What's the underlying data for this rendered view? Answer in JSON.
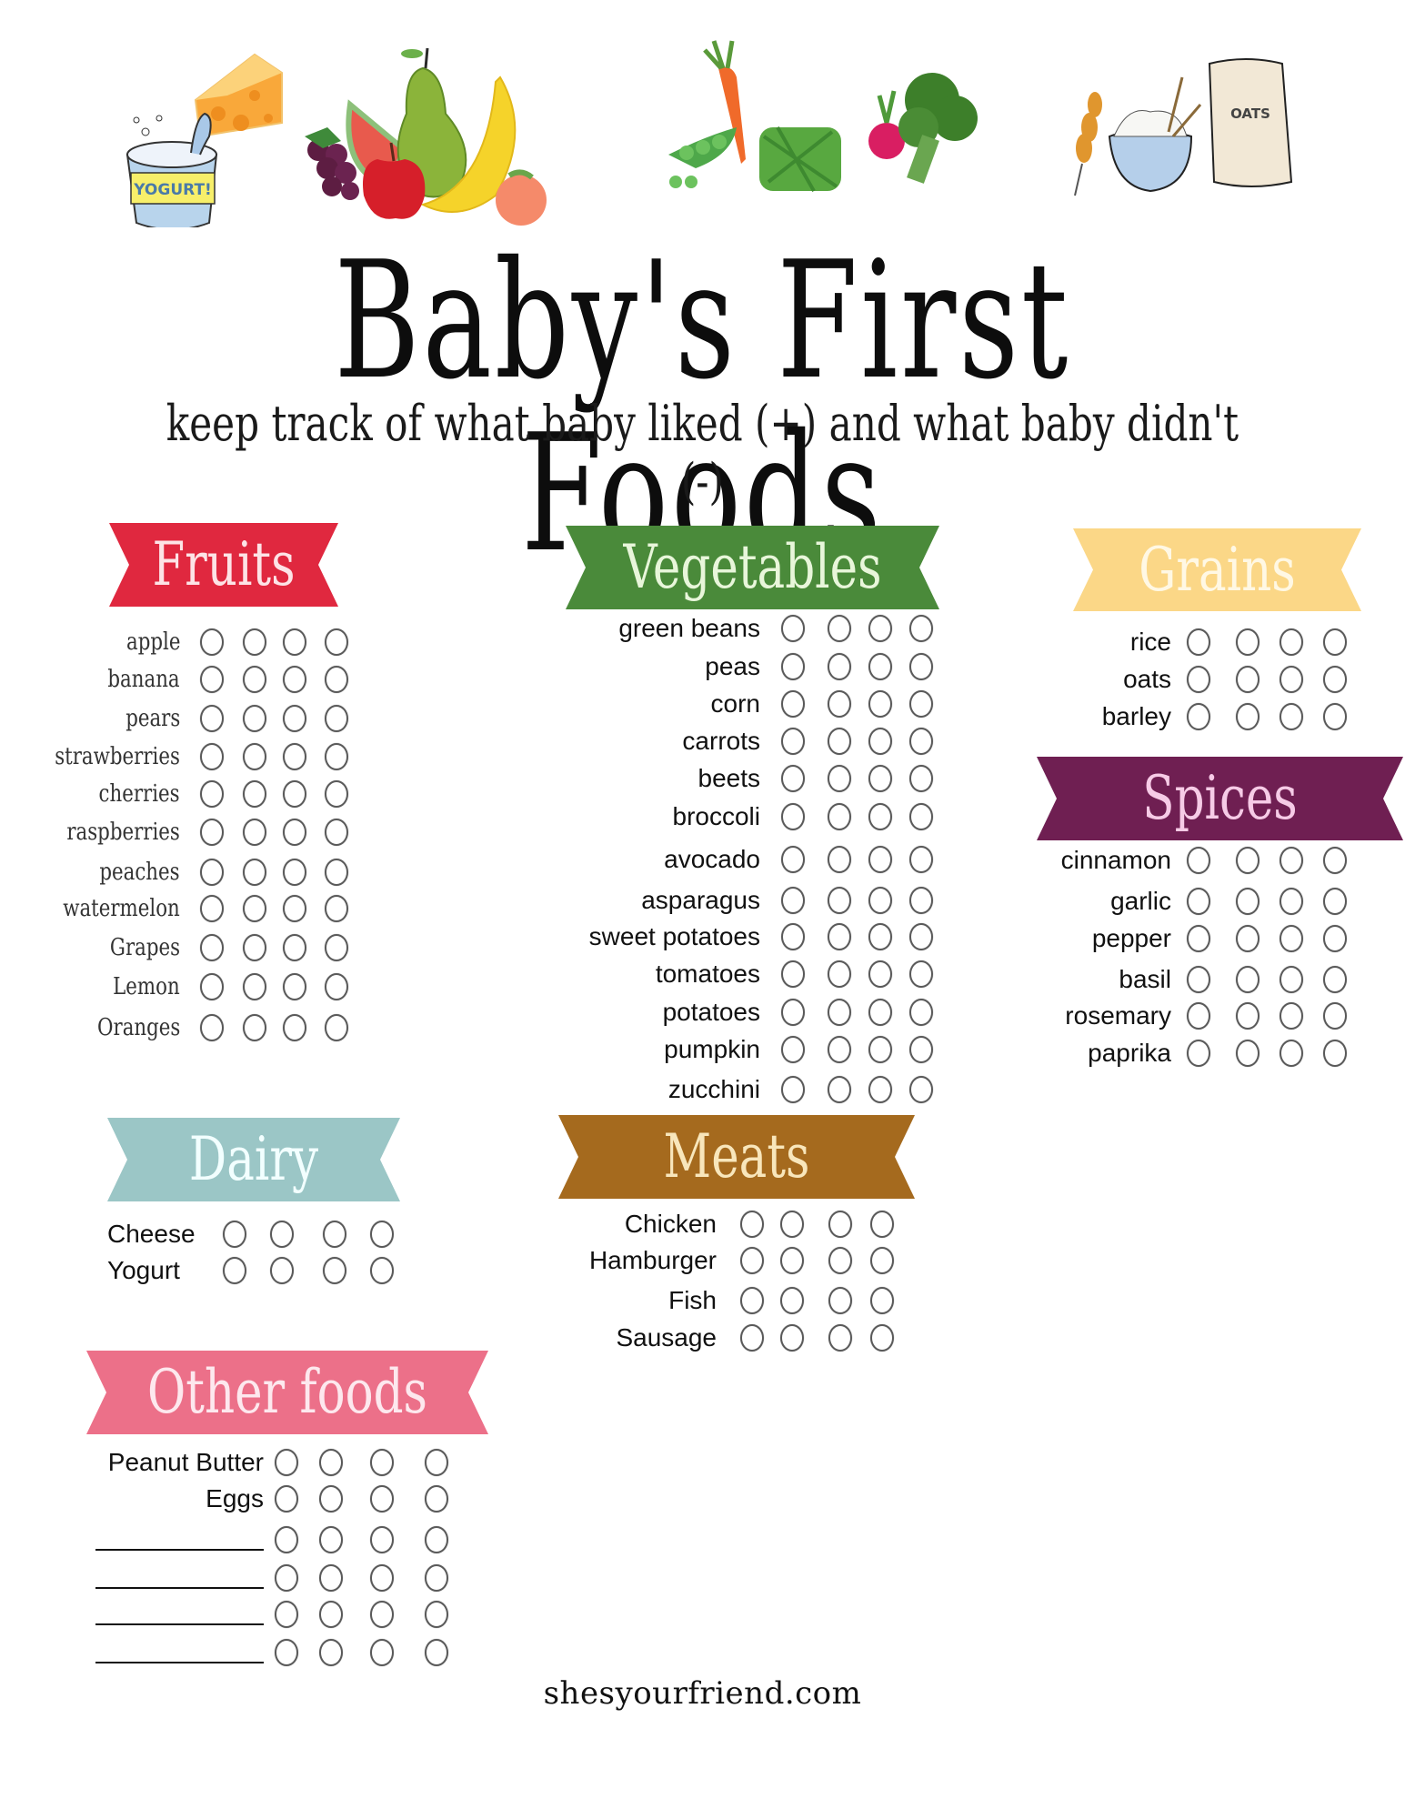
{
  "header": {
    "illustrations": [
      {
        "name": "dairy-illustration",
        "items": [
          "yogurt",
          "cheese"
        ],
        "yogurt_label": "YOGURT!"
      },
      {
        "name": "fruits-illustration",
        "items": [
          "grapes",
          "watermelon",
          "pear",
          "apple",
          "banana",
          "peach"
        ]
      },
      {
        "name": "vegetables-illustration",
        "items": [
          "peas",
          "carrot",
          "green beans",
          "radish",
          "broccoli"
        ]
      },
      {
        "name": "grains-illustration",
        "items": [
          "wheat",
          "rice bowl",
          "oats bag"
        ],
        "oats_label": "OATS"
      }
    ],
    "title": "Baby's First Foods",
    "subtitle": "keep track of what baby liked (+) and what baby didn't (-)"
  },
  "sections": {
    "fruits": {
      "title": "Fruits",
      "color": "#e0283f",
      "text_color": "#fde3e6",
      "items": [
        "apple",
        "banana",
        "pears",
        "strawberries",
        "cherries",
        "raspberries",
        "peaches",
        "watermelon",
        "Grapes",
        "Lemon",
        "Oranges"
      ]
    },
    "vegetables": {
      "title": "Vegetables",
      "color": "#4a8a3a",
      "text_color": "#e8f6da",
      "items": [
        "green beans",
        "peas",
        "corn",
        "carrots",
        "beets",
        "broccoli",
        "avocado",
        "asparagus",
        "sweet potatoes",
        "tomatoes",
        "potatoes",
        "pumpkin",
        "zucchini"
      ]
    },
    "grains": {
      "title": "Grains",
      "color": "#fbd787",
      "text_color": "#fff8e4",
      "items": [
        "rice",
        "oats",
        "barley"
      ]
    },
    "spices": {
      "title": "Spices",
      "color": "#6f1f52",
      "text_color": "#f6cbe6",
      "items": [
        "cinnamon",
        "garlic",
        "pepper",
        "basil",
        "rosemary",
        "paprika"
      ]
    },
    "dairy": {
      "title": "Dairy",
      "color": "#9bc6c6",
      "text_color": "#f2ffff",
      "items": [
        "Cheese",
        "Yogurt"
      ]
    },
    "meats": {
      "title": "Meats",
      "color": "#a56a1e",
      "text_color": "#f8e6bb",
      "items": [
        "Chicken",
        "Hamburger",
        "Fish",
        "Sausage"
      ]
    },
    "other": {
      "title": "Other foods",
      "color": "#ec7089",
      "text_color": "#fde8ee",
      "items": [
        "Peanut Butter",
        "Eggs",
        "",
        "",
        "",
        ""
      ]
    }
  },
  "circles_per_row": 4,
  "footer": "shesyourfriend.com"
}
